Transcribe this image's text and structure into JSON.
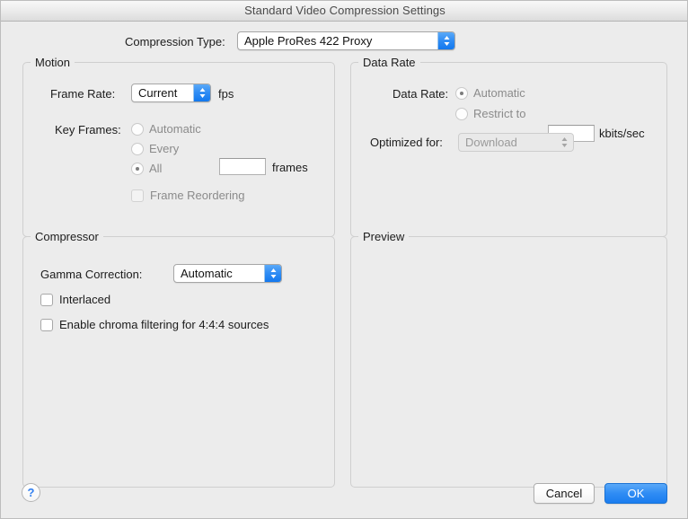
{
  "window": {
    "title": "Standard Video Compression Settings"
  },
  "compression_type": {
    "label": "Compression Type:",
    "value": "Apple ProRes 422 Proxy"
  },
  "motion": {
    "title": "Motion",
    "frame_rate_label": "Frame Rate:",
    "frame_rate_value": "Current",
    "fps_unit": "fps",
    "key_frames_label": "Key Frames:",
    "options": [
      {
        "label": "Automatic",
        "selected": false
      },
      {
        "label": "Every",
        "selected": false
      },
      {
        "label": "All",
        "selected": true
      }
    ],
    "every_field_value": "",
    "frames_unit": "frames",
    "frame_reordering_label": "Frame Reordering",
    "frame_reordering_checked": false
  },
  "data_rate": {
    "title": "Data Rate",
    "data_rate_label": "Data Rate:",
    "options": [
      {
        "label": "Automatic",
        "selected": true
      },
      {
        "label": "Restrict to",
        "selected": false
      }
    ],
    "restrict_field_value": "",
    "kbits_unit": "kbits/sec",
    "optimized_label": "Optimized for:",
    "optimized_value": "Download"
  },
  "compressor": {
    "title": "Compressor",
    "gamma_label": "Gamma Correction:",
    "gamma_value": "Automatic",
    "interlaced_label": "Interlaced",
    "interlaced_checked": false,
    "chroma_label": "Enable chroma filtering for 4:4:4 sources",
    "chroma_checked": false
  },
  "preview": {
    "title": "Preview"
  },
  "footer": {
    "help_label": "?",
    "cancel_label": "Cancel",
    "ok_label": "OK"
  },
  "colors": {
    "accent_blue": "#2f8cf4",
    "window_bg": "#ececec",
    "text": "#1c1c1c",
    "disabled_text": "#8b8b8b"
  }
}
